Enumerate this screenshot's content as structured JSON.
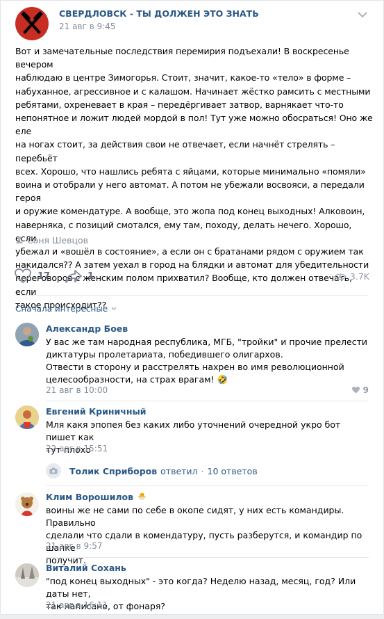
{
  "post": {
    "group_name": "СВЕРДЛОВСК - ТЫ ДОЛЖЕН ЭТО ЗНАТЬ",
    "date": "21 авг в 9:45",
    "text": "Вот и замечательные последствия перемирия подъехали! В воскресенье вечером\nнаблюдаю в центре Зимогорья. Стоит, значит, какое-то «тело» в форме –\nнабуханное, агрессивное и с калашом. Начинает жёстко рамсить с местными\nребятами, охреневает в края – передёргивает затвор, варнякает что-то\nнепонятное и ложит людей мордой в пол! Тут уже можно обосраться! Оно же еле\nна ногах стоит, за действия свои не отвечает, если начнёт стрелять – перебьёт\nвсех. Хорошо, что нашлись ребята с яйцами, которые минимально «помяли»\nвоина и отобрали у него автомат. А потом не убежали восвояси, а передали героя\nи оружие комендатуре. А вообще, это жопа под конец выходных! Алковоин,\nнаверняка, с позиций смотался, ему там, походу, делать нечего. Хорошо, если\nубежал и «вошёл в состояние», а если он с братанами рядом с оружием так\nнакидался?? А затем уехал в город на блядки и автомат для убедительности\nпереговоров с женским полом прихватил? Вообще, кто должен отвечать, если\nтакое происходит??",
    "signer": "Саня Шевцов",
    "likes": "17",
    "shares": "1",
    "views": "3.7K"
  },
  "comments_header": {
    "sort_label": "Сначала интересные"
  },
  "comments": [
    {
      "name": "Александр Боев",
      "text": "У вас же там народная республика, МГБ, \"тройки\" и прочие прелести\nдиктатуры пролетариата, победившего олигархов.\nОтвести в сторону и расстрелять нахрен во имя революционной\nцелесообразности, на страх врагам! 🤣",
      "date": "21 авг в 10:00",
      "likes": "9"
    },
    {
      "name": "Евгений Криничный",
      "text": "Мля какя эпопея без каких либо уточнений очередной укро бот пишет как\nтут плохо",
      "date": "22 авг в 15:51"
    },
    {
      "name": "Клим Ворошилов",
      "badge": "🐣",
      "text": "воины же не сами по себе в окопе сидят, у них есть командиры. Правильно\nсделали что сдали в комендатуру, пусть разберутся, и командир по шапке\nполучит.",
      "date": "21 авг в 9:57"
    },
    {
      "name": "Виталий Сохань",
      "text": "\"под конец выходных\" - это когда? Неделю назад, месяц, год? Или даты нет,\nтак написано, от фонаря?",
      "date": "21 авг в 16:11"
    }
  ],
  "replies_link": {
    "name": "Толик Сприборов",
    "action": "ответил",
    "count": "10 ответов"
  },
  "colors": {
    "link": "#2a5885",
    "meta": "#818c99",
    "like_red": "#e64646"
  },
  "icons": [
    "group-logo-hammers-icon",
    "chevron-down-icon",
    "user-icon",
    "heart-icon",
    "share-arrow-icon",
    "eye-icon",
    "camera-icon"
  ]
}
